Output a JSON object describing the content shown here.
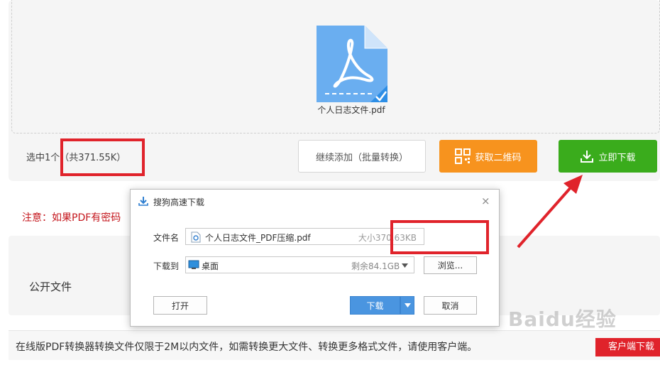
{
  "upload": {
    "file_name": "个人日志文件.pdf",
    "selected_count": "选中1个",
    "total_size": "（共371.55K）"
  },
  "buttons": {
    "add_more": "继续添加（批量转换）",
    "qr_code": "获取二维码",
    "download_now": "立即下载"
  },
  "notice": "注意：如果PDF有密码",
  "panel": {
    "label": "公开文件"
  },
  "bottom": {
    "text": "在线版PDF转换器转换文件仅限于2M以内文件，如需转换更大文件、转换更多格式文件，请使用客户端。",
    "client_button": "客户端下载"
  },
  "watermark": "Baidu经验",
  "dialog": {
    "title": "搜狗高速下载",
    "filename_label": "文件名",
    "filename_value": "个人日志文件_PDF压缩.pdf",
    "size": "大小370.63KB",
    "saveto_label": "下载到",
    "saveto_value": "桌面",
    "free_space": "剩余84.1GB",
    "browse_label": "浏览...",
    "open_label": "打开",
    "download_label": "下载",
    "cancel_label": "取消",
    "close_glyph": "×"
  },
  "colors": {
    "accent_red": "#e0232b",
    "orange": "#f7931e",
    "green": "#3aac1c",
    "pdf_blue": "#6aaef0",
    "dialog_blue": "#4a95e0"
  }
}
